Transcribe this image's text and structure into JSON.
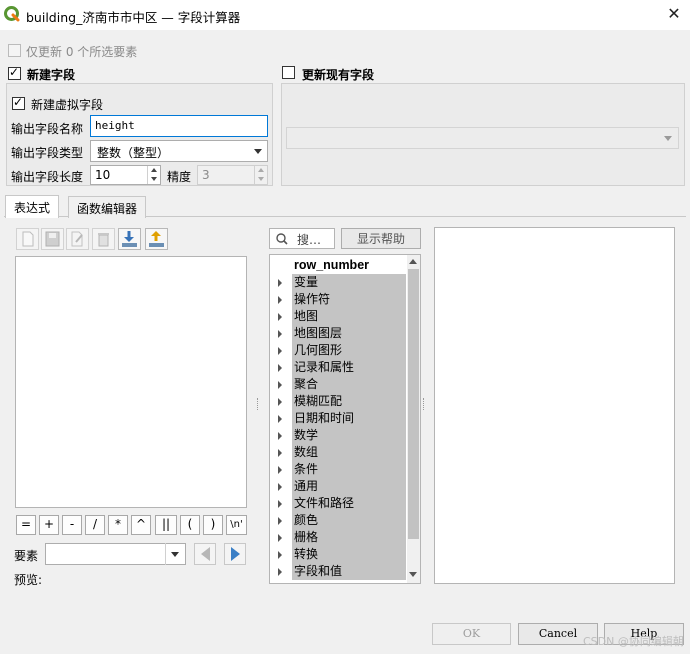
{
  "window": {
    "title": "building_济南市市中区 — 字段计算器",
    "close_glyph": "✕"
  },
  "colors": {
    "qgis_green": "#589632",
    "qgis_yellow": "#ee7913",
    "focus_blue": "#0078d7",
    "tree_highlight": "#c4c4c4",
    "nav_blue": "#3a7fc6"
  },
  "options": {
    "only_update_selected": {
      "label": "仅更新 0 个所选要素",
      "checked": false,
      "enabled": false
    }
  },
  "new_field": {
    "title": "新建字段",
    "checked": true,
    "virtual": {
      "label": "新建虚拟字段",
      "checked": true
    },
    "name_label": "输出字段名称",
    "name_value": "height",
    "type_label": "输出字段类型",
    "type_value": "整数（整型）",
    "length_label": "输出字段长度",
    "length_value": "10",
    "precision_label": "精度",
    "precision_value": "3"
  },
  "update_existing": {
    "title": "更新现有字段",
    "checked": false,
    "field_value": ""
  },
  "tabs": [
    {
      "label": "表达式",
      "active": true
    },
    {
      "label": "函数编辑器",
      "active": false
    }
  ],
  "toolbar_icons": [
    "new-file-icon",
    "save-icon",
    "edit-icon",
    "delete-icon",
    "import-icon",
    "export-icon"
  ],
  "operators": [
    "=",
    "+",
    "-",
    "/",
    "*",
    "^",
    "||",
    "(",
    ")",
    "\\n'"
  ],
  "feature_label": "要素",
  "feature_value": "",
  "preview_label": "预览:",
  "search": {
    "placeholder": "搜…",
    "help_button": "显示帮助"
  },
  "function_tree": {
    "top": "row_number",
    "groups": [
      "变量",
      "操作符",
      "地图",
      "地图图层",
      "几何图形",
      "记录和属性",
      "聚合",
      "模糊匹配",
      "日期和时间",
      "数学",
      "数组",
      "条件",
      "通用",
      "文件和路径",
      "颜色",
      "栅格",
      "转换",
      "字段和值"
    ]
  },
  "buttons": {
    "ok": "OK",
    "cancel": "Cancel",
    "help": "Help"
  },
  "watermark": "CSDN @协同编辑朝"
}
